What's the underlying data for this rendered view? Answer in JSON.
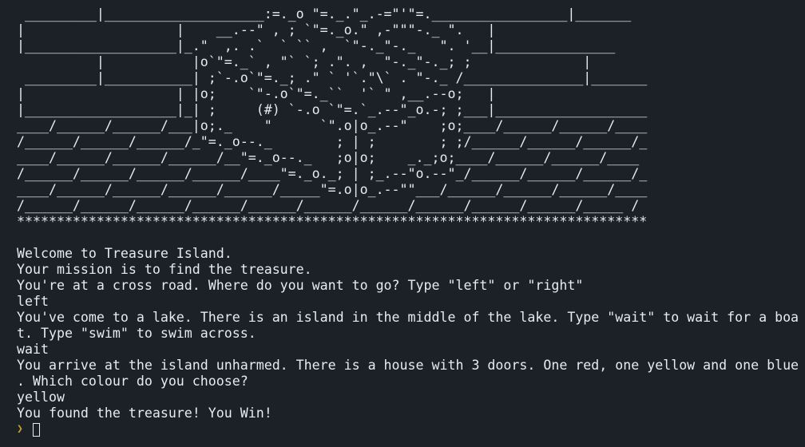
{
  "banner_art": " _________|____________________:=._o \"=._.\"_.-=\"'\"=._________________|_______\n|                   |    __.--\" , ; `\"=._o.\" ,-\"\"\"-._ \".   |\n|___________________|_.\"  ,. .`  ` `` ,  `\"-._\"-._   \". '__|_______________\n          |           |o`\"=._` , \"` `; .\". ,  \"-._\"-._; ;              |\n _________|___________| ;`-.o`\"=._; .\" ` '`.\"\\` . \"-._ /_______________|_______\n|                   | |o;    `\"-.o`\"=._``  '` \" ,__.--o;   |\n|___________________|_| ;     (#) `-.o `\"=.`_.--\"_o.-; ;___|___________________\n____/______/______/___|o;._    \"      `\".o|o_.--\"    ;o;____/______/______/____\n/______/______/______/_\"=._o--._        ; | ;        ; ;/______/______/______/_\n____/______/______/______/__\"=._o--._   ;o|o;    _._;o;____/______/______/____\n/______/______/______/______/____\"=._o._; | ;_.--\"o.--\"_/______/______/______/_\n____/______/______/______/______/_____\"=.o|o_.--\"\"___/______/______/______/____\n/______/______/______/______/______/______/______/______/______/______/_____ /\n*******************************************************************************",
  "transcript": [
    "Welcome to Treasure Island.",
    "Your mission is to find the treasure.",
    "You're at a cross road. Where do you want to go? Type \"left\" or \"right\"",
    "left",
    "You've come to a lake. There is an island in the middle of the lake. Type \"wait\" to wait for a boa",
    "t. Type \"swim\" to swim across.",
    "wait",
    "You arrive at the island unharmed. There is a house with 3 doors. One red, one yellow and one blue",
    ". Which colour do you choose?",
    "yellow",
    "You found the treasure! You Win!"
  ],
  "prompt": {
    "glyph": "❯",
    "icon": "prompt-chevron-icon",
    "input_value": ""
  },
  "colors": {
    "background": "#1c2128",
    "foreground": "#e8eaed",
    "prompt_accent": "#c9a227"
  }
}
